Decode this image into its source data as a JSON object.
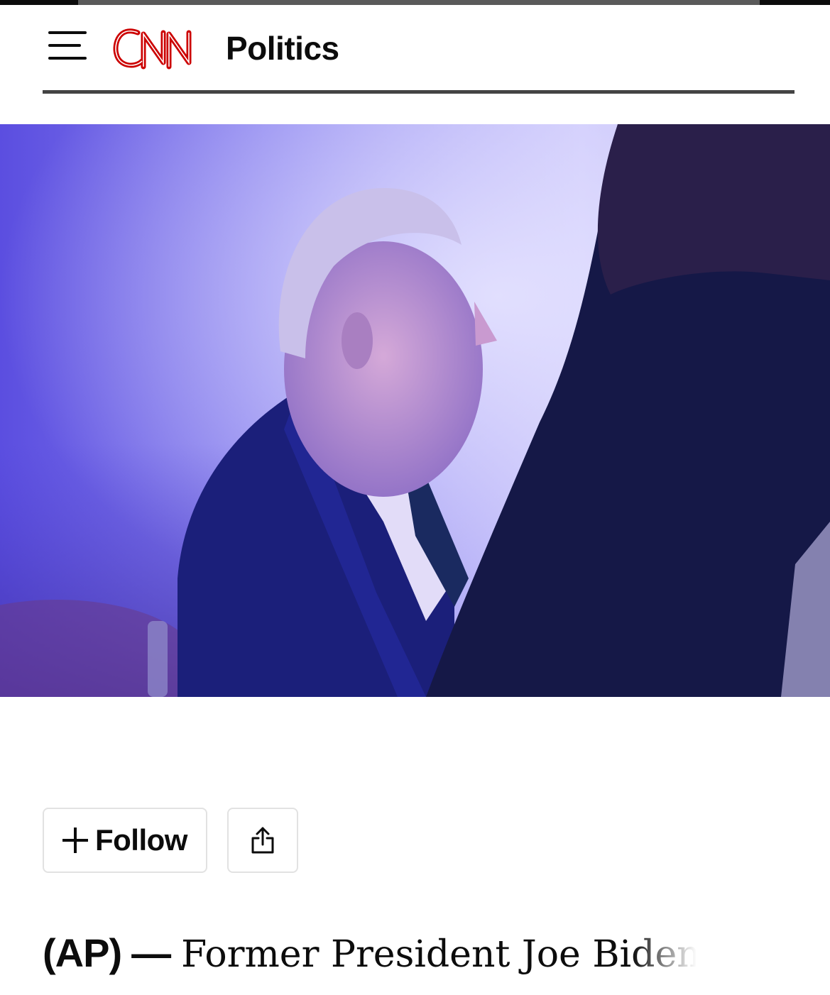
{
  "header": {
    "brand": "CNN",
    "section": "Politics",
    "menu_icon": "hamburger-menu-icon",
    "brand_color": "#cc0000"
  },
  "hero_image": {
    "description_icon": "photo"
  },
  "actions": {
    "follow_label": "Follow",
    "follow_icon": "plus-icon",
    "share_icon": "share-icon"
  },
  "article": {
    "dateline": "(AP)",
    "separator": "—",
    "lede": "Former President Joe Biden"
  }
}
